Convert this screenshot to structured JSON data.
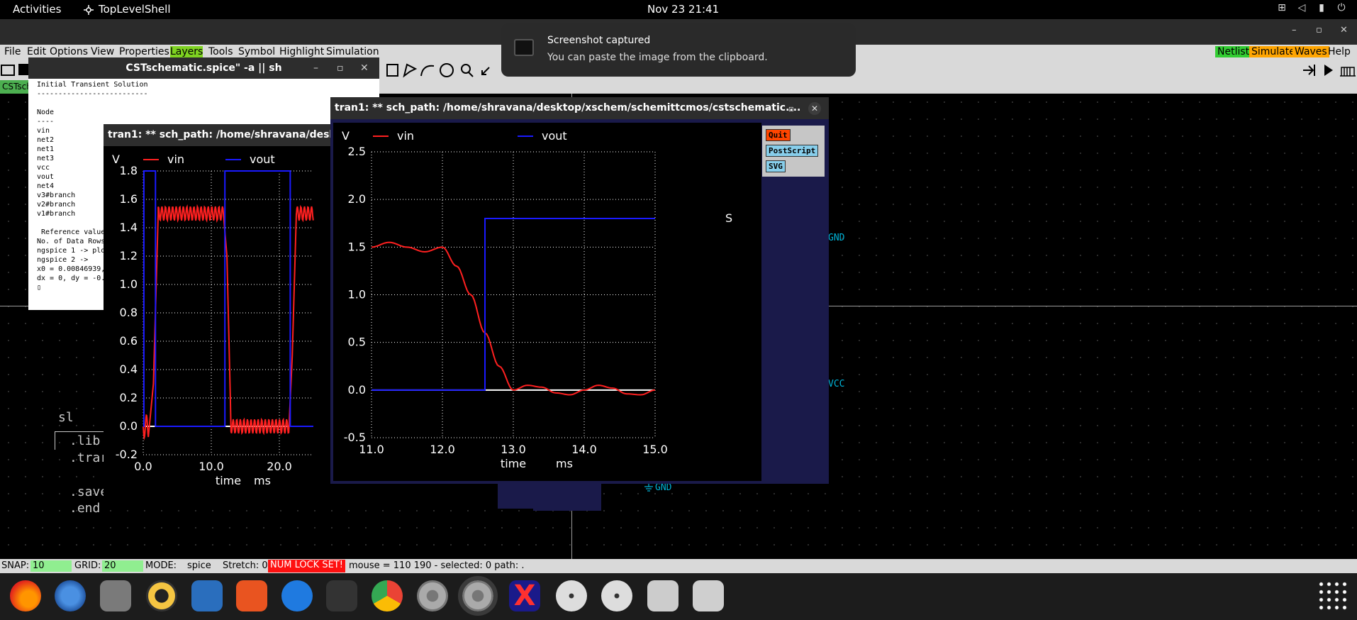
{
  "topbar": {
    "activities": "Activities",
    "app_name": "TopLevelShell",
    "clock": "Nov 23  21:41"
  },
  "menubar": {
    "items": [
      "File",
      "Edit",
      "Options",
      "View",
      "Properties",
      "Layers",
      "Tools",
      "Symbol",
      "Highlight",
      "Simulation"
    ],
    "right": [
      "Netlist",
      "Simulate",
      "Waves",
      "Help"
    ]
  },
  "tab": {
    "label": "CSTsch"
  },
  "schematic": {
    "texts": [
      "sl",
      ".lib",
      ".trar",
      ".save",
      ".end"
    ],
    "net_labels": [
      "GND",
      "VCC",
      "GND"
    ]
  },
  "statusbar": {
    "snap_label": "SNAP:",
    "snap_value": "10",
    "grid_label": "GRID:",
    "grid_value": "20",
    "mode_label": "MODE:",
    "mode_value": "spice",
    "stretch": "Stretch: 0",
    "numlock": "NUM LOCK SET!",
    "mouse": "mouse = 110 190 - selected: 0 path: ."
  },
  "notification": {
    "title": "Screenshot captured",
    "body": "You can paste the image from the clipboard."
  },
  "terminal": {
    "title": "CSTschematic.spice\" -a || sh",
    "lines": [
      "Initial Transient Solution",
      "--------------------------",
      "",
      "Node",
      "----",
      "vin",
      "net2",
      "net1",
      "net3",
      "vcc",
      "vout",
      "net4",
      "v3#branch",
      "v2#branch",
      "v1#branch",
      "",
      " Reference value",
      "No. of Data Rows",
      "ngspice 1 -> plo",
      "ngspice 2 ->",
      "x0 = 0.00846939,",
      "dx = 0, dy = -0.",
      "▯"
    ]
  },
  "plot_back": {
    "title": "tran1: ** sch_path: /home/shravana/desktop/x",
    "ylabel": "V",
    "xlabel": "time",
    "xunit": "ms"
  },
  "plot_front": {
    "title": "tran1: ** sch_path: /home/shravana/desktop/xschem/schemittcmos/cstschematic....",
    "ylabel": "V",
    "xlabel": "time",
    "xunit": "ms",
    "side_letter": "S",
    "buttons": [
      "Quit",
      "PostScript",
      "SVG"
    ]
  },
  "chart_data": [
    {
      "type": "line",
      "title": "",
      "xlabel": "time",
      "ylabel": "V",
      "xlim": [
        0,
        25
      ],
      "ylim": [
        -0.2,
        1.8
      ],
      "xticks": [
        "0.0",
        "10.0",
        "20.0"
      ],
      "yticks": [
        "1.8",
        "1.6",
        "1.4",
        "1.2",
        "1.0",
        "0.8",
        "0.6",
        "0.4",
        "0.2",
        "0.0",
        "-0.2"
      ],
      "grid": true,
      "legend": "top",
      "series": [
        {
          "name": "vin",
          "color": "#ff2020",
          "shape": "ringing square wave",
          "x": [
            0,
            0.4,
            0.7,
            1.5,
            2.5,
            12.0,
            12.6,
            13.2,
            21.6,
            22.2,
            25
          ],
          "y": [
            0,
            0.0,
            0.0,
            0.1,
            1.5,
            1.5,
            0.5,
            0.0,
            0.0,
            1.0,
            1.5
          ]
        },
        {
          "name": "vout",
          "color": "#1a1aff",
          "x": [
            0,
            0.1,
            0.1,
            1.8,
            1.8,
            12.0,
            12.0,
            21.6,
            21.6,
            25
          ],
          "y": [
            0,
            0,
            1.8,
            1.8,
            0,
            0,
            1.8,
            1.8,
            0,
            0
          ]
        }
      ]
    },
    {
      "type": "line",
      "title": "",
      "xlabel": "time",
      "ylabel": "V",
      "xlim": [
        11.0,
        15.0
      ],
      "ylim": [
        -0.5,
        2.5
      ],
      "xticks": [
        "11.0",
        "12.0",
        "13.0",
        "14.0",
        "15.0"
      ],
      "yticks": [
        "2.5",
        "2.0",
        "1.5",
        "1.0",
        "0.5",
        "0.0",
        "-0.5"
      ],
      "grid": true,
      "legend": "top",
      "series": [
        {
          "name": "vin",
          "color": "#ff2020",
          "x": [
            11.0,
            11.25,
            11.5,
            11.75,
            12.0,
            12.2,
            12.4,
            12.6,
            12.8,
            13.0,
            13.2,
            13.4,
            13.6,
            13.8,
            14.0,
            14.2,
            14.4,
            14.6,
            14.8,
            15.0
          ],
          "y": [
            1.5,
            1.55,
            1.5,
            1.45,
            1.5,
            1.3,
            1.0,
            0.6,
            0.25,
            0.0,
            0.05,
            0.03,
            -0.03,
            -0.05,
            0.0,
            0.05,
            0.02,
            -0.04,
            -0.05,
            0.0
          ]
        },
        {
          "name": "vout",
          "color": "#1a1aff",
          "x": [
            11.0,
            12.6,
            12.6,
            15.0
          ],
          "y": [
            0,
            0,
            1.8,
            1.8
          ]
        }
      ]
    }
  ]
}
